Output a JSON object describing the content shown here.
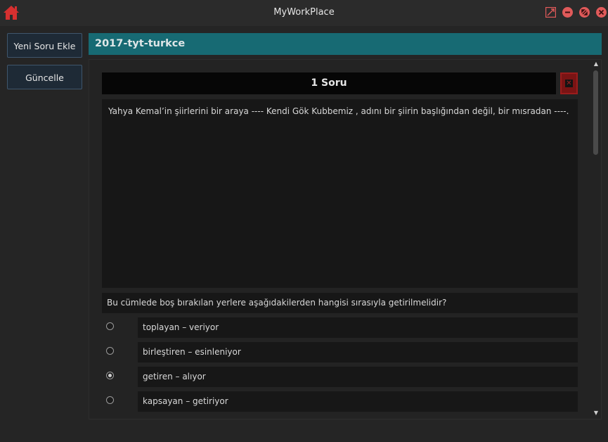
{
  "window": {
    "title": "MyWorkPlace",
    "icons": [
      "home-icon",
      "maximize-icon",
      "minimize-icon",
      "restore-icon",
      "close-icon"
    ]
  },
  "sidebar": {
    "add_question_label": "Yeni Soru Ekle",
    "update_label": "Güncelle"
  },
  "tab": {
    "title": "2017-tyt-turkce"
  },
  "question": {
    "header": "1 Soru",
    "close_glyph": "✕",
    "text": "Yahya Kemal’in şiirlerini bir araya ---- Kendi Gök Kubbemiz , adını bir şiirin başlığından değil, bir mısradan ----.",
    "prompt": "Bu cümlede boş bırakılan yerlere  aşağıdakilerden hangisi sırasıyla  getirilmelidir?",
    "options": [
      {
        "label": "toplayan  –  veriyor",
        "selected": false
      },
      {
        "label": "birleştiren –  esinleniyor",
        "selected": false
      },
      {
        "label": "getiren  – alıyor",
        "selected": true
      },
      {
        "label": "kapsayan  –  getiriyor",
        "selected": false
      }
    ]
  },
  "colors": {
    "accent": "#176a73",
    "button_bg": "#1e2a36",
    "close_red": "#7a1414",
    "home_red": "#d63030"
  }
}
